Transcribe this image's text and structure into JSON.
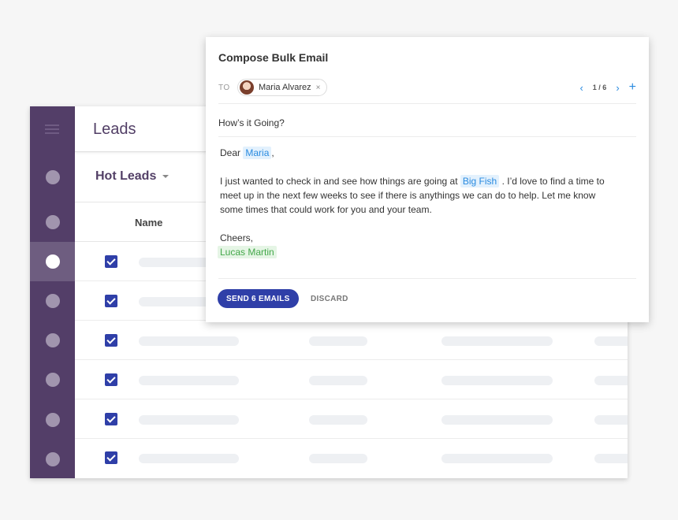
{
  "app": {
    "title": "Leads",
    "filter": {
      "selected": "Hot Leads"
    },
    "table": {
      "columns": [
        "Name"
      ],
      "rows": 6
    },
    "colors": {
      "sidebar": "#533e68",
      "accent": "#2f3fa8"
    }
  },
  "compose": {
    "title": "Compose Bulk Email",
    "to_label": "TO",
    "recipient": {
      "name": "Maria Alvarez",
      "remove_glyph": "×"
    },
    "pager": {
      "prev": "‹",
      "count": "1 / 6",
      "next": "›",
      "add": "+"
    },
    "subject": "How’s it Going?",
    "greeting": "Dear",
    "greeting_name": "Maria",
    "greeting_suffix": ",",
    "body_intro": "I just wanted to check in and see how things are going at",
    "company": "Big Fish",
    "body_rest_1": ". I’d love to find a time to",
    "body_rest_2": "meet up in the next few weeks to see if there is anythings we can do to help. Let me know",
    "body_rest_3": "some times that could work for you and your team.",
    "signoff": "Cheers,",
    "sender": "Lucas Martin",
    "send_label": "SEND 6 EMAILS",
    "discard_label": "DISCARD"
  }
}
